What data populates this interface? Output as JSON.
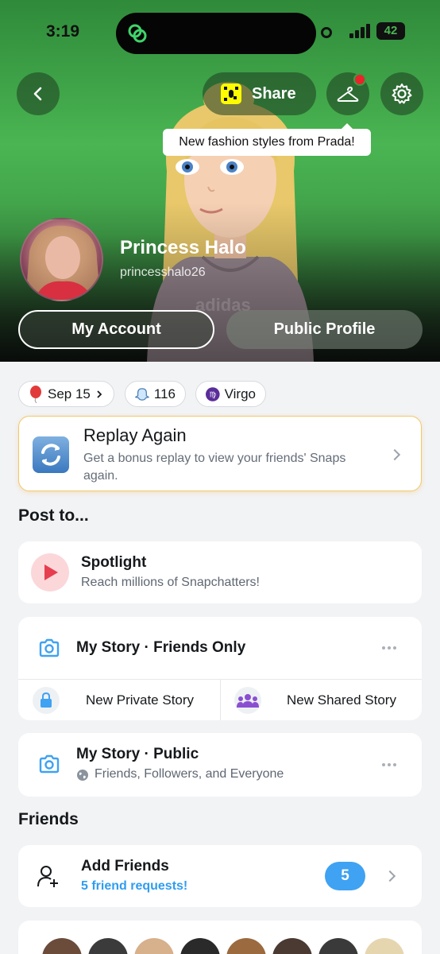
{
  "status_bar": {
    "time": "3:19",
    "battery": "42"
  },
  "header": {
    "share_label": "Share",
    "tooltip": "New fashion styles from Prada!",
    "display_name": "Princess Halo",
    "username": "princesshalo26",
    "my_account_label": "My Account",
    "public_profile_label": "Public Profile",
    "hoodie_brand": "adidas"
  },
  "chips": {
    "date": "Sep 15",
    "score": "116",
    "zodiac": "Virgo"
  },
  "replay": {
    "title": "Replay Again",
    "description": "Get a bonus replay to view your friends' Snaps again."
  },
  "post_to": {
    "section_title": "Post to...",
    "spotlight_title": "Spotlight",
    "spotlight_subtitle": "Reach millions of Snapchatters!",
    "my_story_friends": "My Story · Friends Only",
    "new_private_story": "New Private Story",
    "new_shared_story": "New Shared Story",
    "my_story_public": "My Story · Public",
    "public_audience": "Friends, Followers, and Everyone"
  },
  "friends": {
    "section_title": "Friends",
    "add_friends_title": "Add Friends",
    "requests_text": "5 friend requests!",
    "requests_count": "5"
  },
  "colors": {
    "header_green": "#4ab552",
    "accent_blue": "#3fa2f2",
    "spotlight_red": "#e63e4f",
    "snap_yellow": "#fffc00",
    "notification_red": "#e8242b"
  }
}
